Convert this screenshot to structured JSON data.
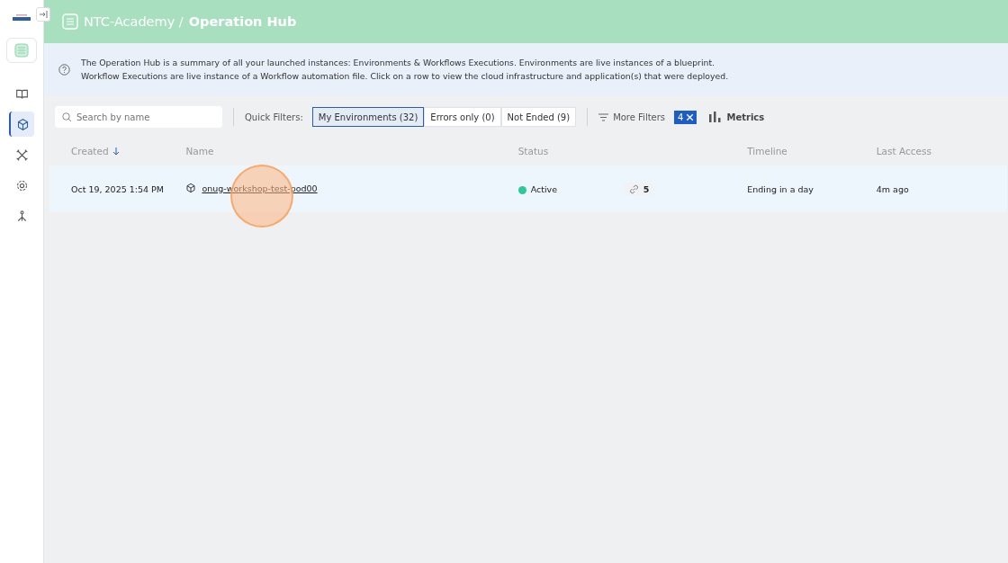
{
  "header": {
    "org": "NTC-Academy /",
    "title": "Operation Hub"
  },
  "sidebar": {
    "items": [
      {
        "selected": false
      },
      {
        "selected": true
      },
      {
        "selected": false
      },
      {
        "selected": false
      },
      {
        "selected": false
      }
    ]
  },
  "info": "The Operation Hub is a summary of all your launched instances: Environments & Workflows Executions. Environments are live instances of a blueprint.\nWorkflow Executions are live instance of a Workflow automation file. Click on a row to view the cloud infrastructure and application(s) that were deployed.",
  "search": {
    "placeholder": "Search by name"
  },
  "quick_filters": {
    "label": "Quick Filters:",
    "items": [
      {
        "label": "My Environments (32)",
        "selected": true
      },
      {
        "label": "Errors only (0)",
        "selected": false
      },
      {
        "label": "Not Ended (9)",
        "selected": false
      }
    ]
  },
  "more_filters": {
    "label": "More Filters",
    "count": "4"
  },
  "metrics": "Metrics",
  "table": {
    "columns": [
      {
        "label": "Created",
        "sorted": true
      },
      {
        "label": "Name",
        "sorted": false
      },
      {
        "label": "Status",
        "sorted": false
      },
      {
        "label": "Timeline",
        "sorted": false
      },
      {
        "label": "Last Access",
        "sorted": false
      }
    ],
    "rows": [
      {
        "created": "Oct 19, 2025 1:54 PM",
        "name": "onug-workshop-test-pod00",
        "status": "Active",
        "color": "#2ec99a",
        "links": "5",
        "timeline": "Ending in a day",
        "last_access": "4m ago"
      }
    ]
  }
}
